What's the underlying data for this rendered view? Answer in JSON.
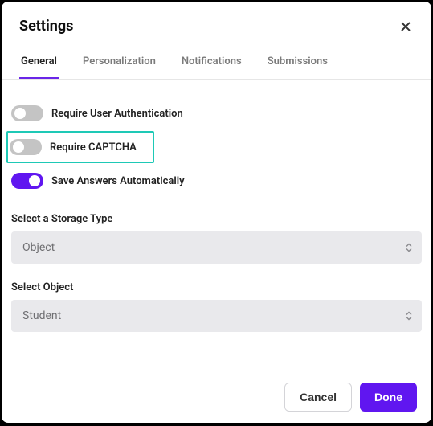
{
  "title": "Settings",
  "tabs": {
    "general": "General",
    "personalization": "Personalization",
    "notifications": "Notifications",
    "submissions": "Submissions"
  },
  "toggles": {
    "auth": {
      "label": "Require User Authentication",
      "on": false
    },
    "captcha": {
      "label": "Require CAPTCHA",
      "on": false
    },
    "autosave": {
      "label": "Save Answers Automatically",
      "on": true
    }
  },
  "fields": {
    "storage": {
      "label": "Select a Storage Type",
      "value": "Object"
    },
    "object": {
      "label": "Select Object",
      "value": "Student"
    }
  },
  "buttons": {
    "cancel": "Cancel",
    "done": "Done"
  }
}
